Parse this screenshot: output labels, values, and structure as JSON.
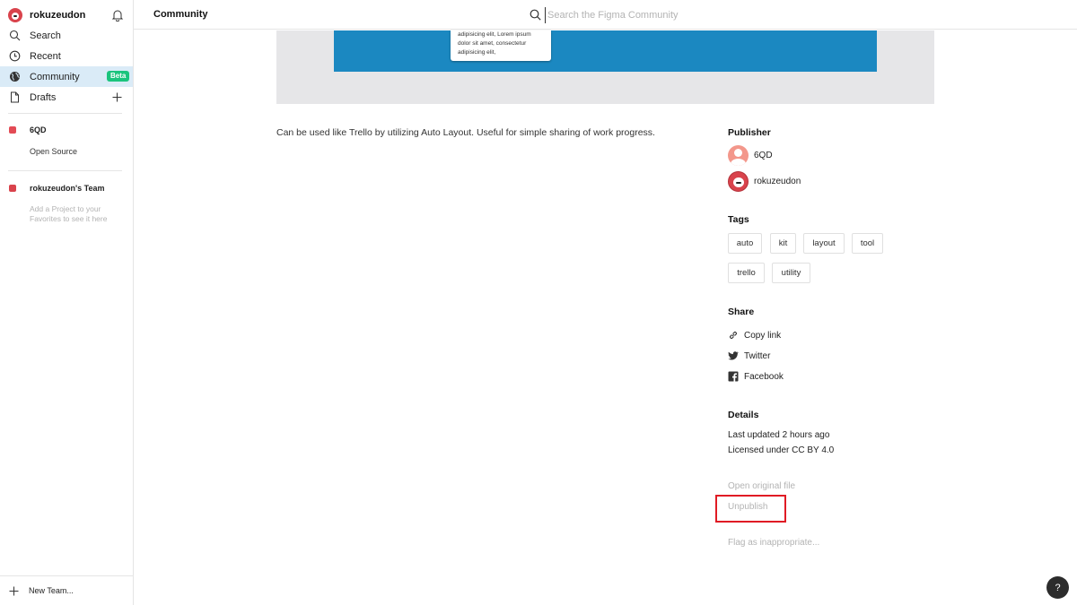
{
  "sidebar": {
    "user": {
      "name": "rokuzeudon"
    },
    "nav": [
      {
        "label": "Search",
        "icon": "search-icon"
      },
      {
        "label": "Recent",
        "icon": "clock-icon"
      },
      {
        "label": "Community",
        "icon": "globe-icon",
        "badge": "Beta",
        "active": true
      },
      {
        "label": "Drafts",
        "icon": "file-icon"
      }
    ],
    "team1": {
      "name": "6QD",
      "items": [
        "Open Source"
      ]
    },
    "team2": {
      "name": "rokuzeudon's Team",
      "hint": "Add a Project to your Favorites to see it here"
    },
    "new_team": "New Team..."
  },
  "header": {
    "title": "Community",
    "search_placeholder": "Search the Figma Community"
  },
  "preview": {
    "card_lines": [
      "adipisicing elit, Lorem ipsum",
      "dolor sit amet, consectetur",
      "adipisicing elit,"
    ]
  },
  "description": "Can be used like Trello by utilizing Auto Layout. Useful for simple sharing of work progress.",
  "publisher": {
    "title": "Publisher",
    "items": [
      "6QD",
      "rokuzeudon"
    ]
  },
  "tags": {
    "title": "Tags",
    "items": [
      "auto",
      "kit",
      "layout",
      "tool",
      "trello",
      "utility"
    ]
  },
  "share": {
    "title": "Share",
    "items": [
      {
        "label": "Copy link",
        "icon": "link-icon"
      },
      {
        "label": "Twitter",
        "icon": "twitter-icon"
      },
      {
        "label": "Facebook",
        "icon": "facebook-icon"
      }
    ]
  },
  "details": {
    "title": "Details",
    "last_updated": "Last updated 2 hours ago",
    "license": "Licensed under CC BY 4.0"
  },
  "actions": {
    "open_original": "Open original file",
    "unpublish": "Unpublish",
    "flag": "Flag as inappropriate..."
  },
  "help": "?",
  "colors": {
    "accent_active": "#daebf7",
    "badge": "#1bc47d",
    "preview_blue": "#1b88c1",
    "highlight": "#e01b24"
  }
}
